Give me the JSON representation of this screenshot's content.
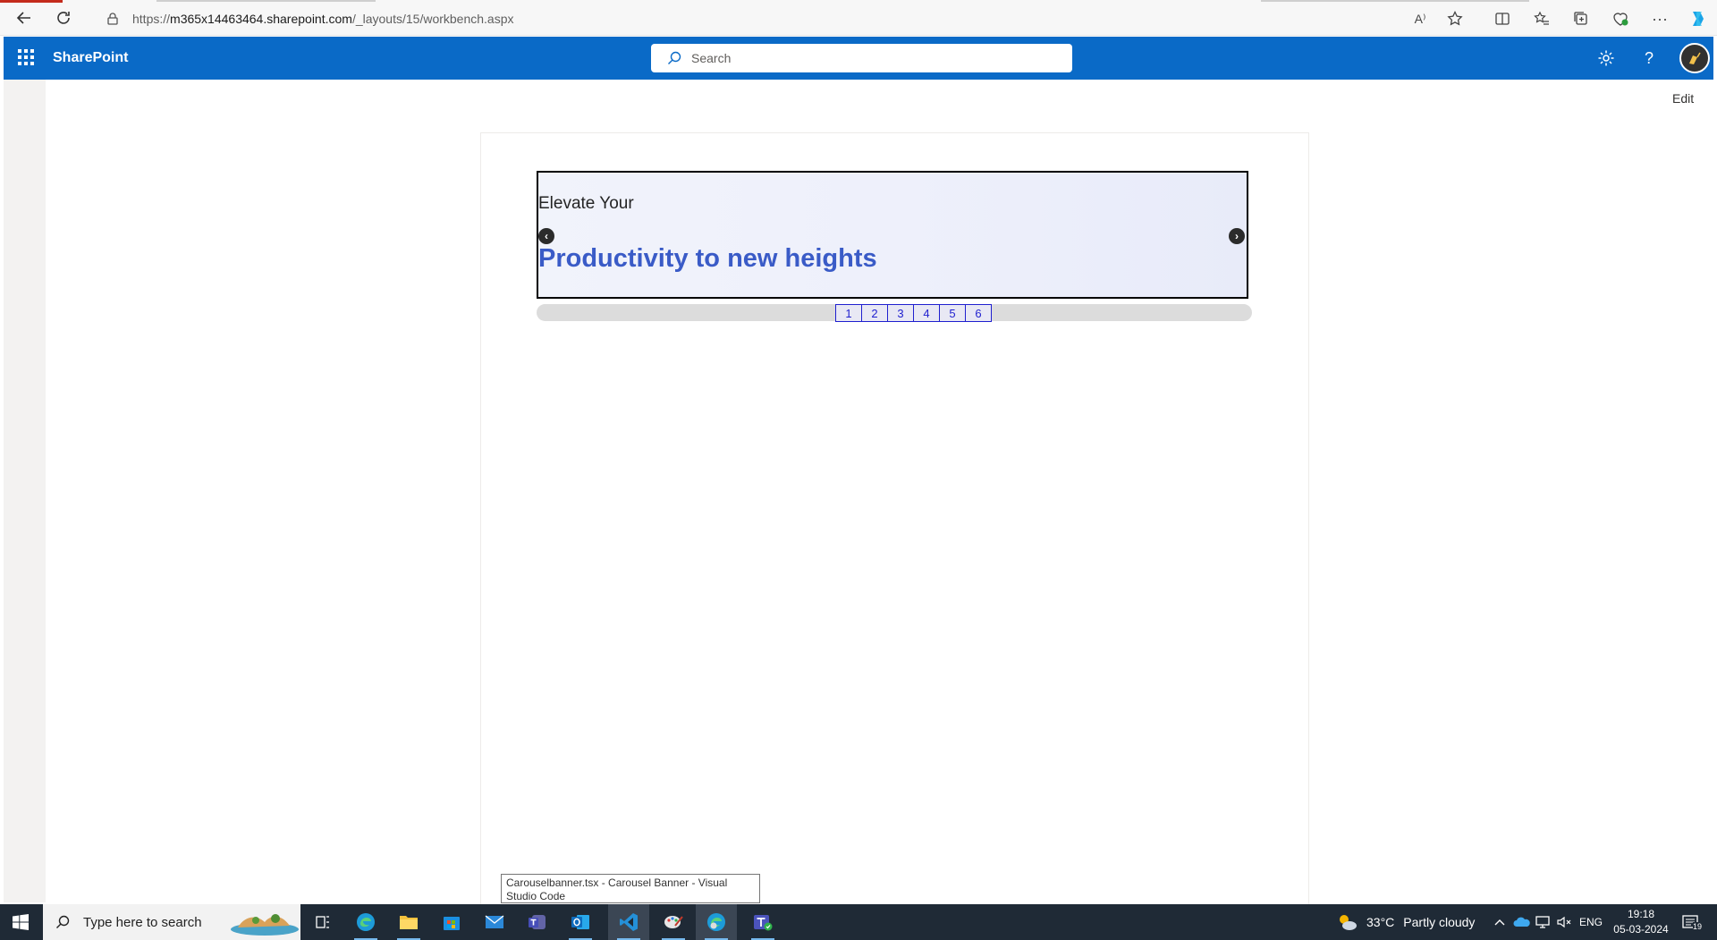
{
  "browser": {
    "url_prefix": "https://",
    "url_host": "m365x14463464.sharepoint.com",
    "url_path": "/_layouts/15/workbench.aspx",
    "read_aloud_label": "A⁾"
  },
  "suitebar": {
    "title": "SharePoint",
    "search_placeholder": "Search",
    "help_label": "?"
  },
  "page": {
    "edit_label": "Edit"
  },
  "carousel": {
    "eyebrow": "Elevate Your",
    "headline": "Productivity to new heights",
    "prev_label": "‹",
    "next_label": "›",
    "pages": [
      "1",
      "2",
      "3",
      "4",
      "5",
      "6"
    ],
    "headline_color": "#3a5bc7"
  },
  "tooltip": {
    "text": "Carouselbanner.tsx - Carousel Banner - Visual Studio Code"
  },
  "taskbar": {
    "search_placeholder": "Type here to search",
    "weather_temp": "33°C",
    "weather_desc": "Partly cloudy",
    "language": "ENG",
    "time": "19:18",
    "date": "05-03-2024",
    "notification_count": "19"
  },
  "colors": {
    "suitebar": "#0a6ac7",
    "taskbar": "#1f2a36"
  }
}
